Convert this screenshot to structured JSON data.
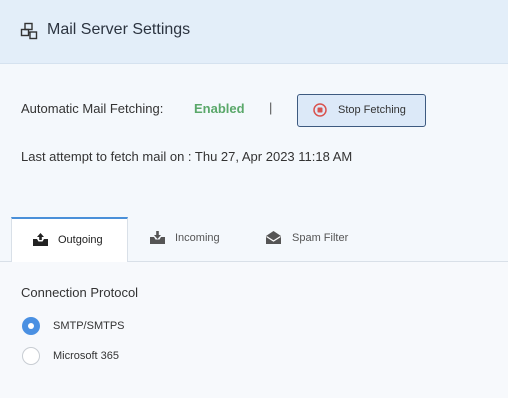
{
  "header": {
    "title": "Mail Server Settings",
    "icon": "server-settings-icon"
  },
  "fetching": {
    "label": "Automatic Mail Fetching:",
    "status": "Enabled",
    "status_color": "#5aa86a",
    "separator": "|",
    "stop_button": "Stop Fetching",
    "last_attempt": "Last attempt to fetch mail on : Thu 27, Apr 2023 11:18 AM"
  },
  "tabs": [
    {
      "label": "Outgoing",
      "icon": "outbox-tray-icon",
      "active": true
    },
    {
      "label": "Incoming",
      "icon": "inbox-tray-icon",
      "active": false
    },
    {
      "label": "Spam Filter",
      "icon": "spam-envelope-icon",
      "active": false
    }
  ],
  "connection": {
    "title": "Connection Protocol",
    "options": [
      {
        "label": "SMTP/SMTPS",
        "selected": true
      },
      {
        "label": "Microsoft 365",
        "selected": false
      }
    ]
  },
  "colors": {
    "accent": "#4a90e2",
    "header_bg": "#e3eef9",
    "stop_icon": "#d9534f"
  }
}
